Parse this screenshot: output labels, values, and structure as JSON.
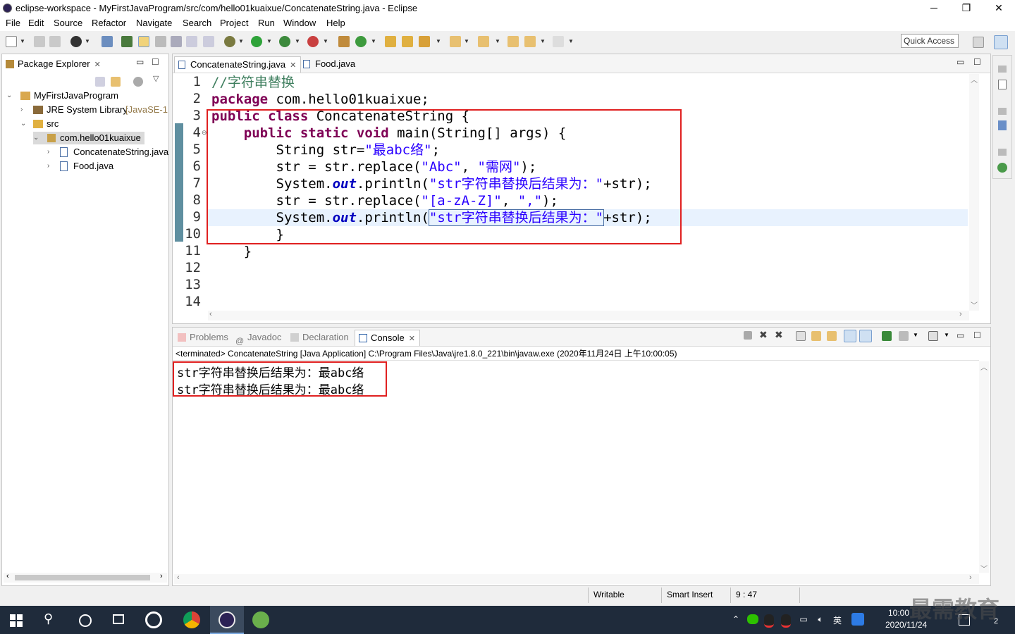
{
  "window": {
    "title": "eclipse-workspace - MyFirstJavaProgram/src/com/hello01kuaixue/ConcatenateString.java - Eclipse",
    "minimize": "─",
    "maximize": "❐",
    "close": "✕"
  },
  "menu": [
    "File",
    "Edit",
    "Source",
    "Refactor",
    "Navigate",
    "Search",
    "Project",
    "Run",
    "Window",
    "Help"
  ],
  "toolbar": {
    "quick_access": "Quick Access"
  },
  "package_explorer": {
    "tab_label": "Package Explorer",
    "project": "MyFirstJavaProgram",
    "jre": "JRE System Library",
    "jre_suffix": "[JavaSE-1.",
    "src": "src",
    "package": "com.hello01kuaixue",
    "files": [
      "ConcatenateString.java",
      "Food.java"
    ]
  },
  "editor": {
    "tabs": [
      "ConcatenateString.java",
      "Food.java"
    ],
    "line_numbers": [
      "1",
      "2",
      "3",
      "4",
      "5",
      "6",
      "7",
      "8",
      "9",
      "10",
      "11",
      "12",
      "13",
      "14"
    ],
    "lines": {
      "l1_comment": "//字符串替换",
      "l2_kw": "package",
      "l2_rest": " com.hello01kuaixue;",
      "l3_kw": "public class",
      "l3_rest": " ConcatenateString {",
      "l4_kw": "public static void",
      "l4_rest": " main(String[] args) {",
      "l5_a": "String str=",
      "l5_str": "\"最abc络\"",
      "l5_b": ";",
      "l6_a": "str = str.replace(",
      "l6_s1": "\"Abc\"",
      "l6_b": ", ",
      "l6_s2": "\"需网\"",
      "l6_c": ");",
      "l7_a": "System.",
      "l7_out": "out",
      "l7_b": ".println(",
      "l7_str": "\"str字符串替换后结果为：\"",
      "l7_c": "+str);",
      "l8_a": "str = str.replace(",
      "l8_s1": "\"[a-zA-Z]\"",
      "l8_b": ", ",
      "l8_s2": "\",\"",
      "l8_c": ");",
      "l9_a": "System.",
      "l9_out": "out",
      "l9_b": ".println(",
      "l9_str": "\"str字符串替换后结果为：\"",
      "l9_c": "+str);",
      "l10": "}",
      "l11": "}"
    }
  },
  "console": {
    "tabs": [
      "Problems",
      "Javadoc",
      "Declaration",
      "Console"
    ],
    "terminated": "<terminated> ConcatenateString [Java Application] C:\\Program Files\\Java\\jre1.8.0_221\\bin\\javaw.exe (2020年11月24日 上午10:00:05)",
    "output": [
      "str字符串替换后结果为：最abc络",
      "str字符串替换后结果为：最abc络"
    ]
  },
  "status": {
    "writable": "Writable",
    "insert_mode": "Smart Insert",
    "position": "9 : 47"
  },
  "taskbar": {
    "time": "10:00",
    "date": "2020/11/24",
    "ime": "英",
    "notification_count": "2",
    "watermark": "最需教育"
  },
  "colors": {
    "keyword": "#7f0055",
    "string": "#2a00ff",
    "comment": "#3f7f5f",
    "highlight_box": "#e02020",
    "taskbar": "#1f2b3b"
  }
}
